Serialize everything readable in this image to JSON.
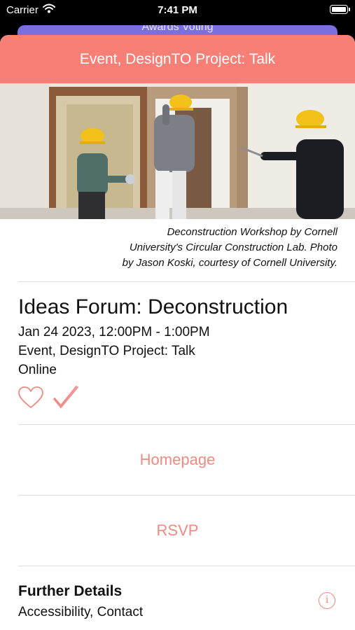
{
  "status_bar": {
    "carrier": "Carrier",
    "time": "7:41 PM"
  },
  "background_card": {
    "label": "Awards Voting",
    "color": "#7b6fe0"
  },
  "header": {
    "title": "Event, DesignTO Project: Talk",
    "color": "#f77f76"
  },
  "hero": {
    "description": "photo of three people in hard hats and protective masks working on a wall during deconstruction"
  },
  "caption": {
    "line1": "Deconstruction Workshop by Cornell",
    "line2": "University's Circular Construction Lab. Photo",
    "line3": "by Jason Koski, courtesy of Cornell University."
  },
  "event": {
    "title": "Ideas Forum: Deconstruction",
    "datetime": "Jan 24 2023, 12:00PM - 1:00PM",
    "category": "Event, DesignTO Project: Talk",
    "location": "Online"
  },
  "actions": {
    "favorite_icon": "heart-icon",
    "attend_icon": "checkmark-icon",
    "accent": "#f08a82"
  },
  "links": {
    "homepage": "Homepage",
    "rsvp": "RSVP"
  },
  "details": {
    "heading": "Further Details",
    "subtitle": "Accessibility, Contact",
    "info_icon": "info-icon",
    "info_glyph": "i"
  }
}
